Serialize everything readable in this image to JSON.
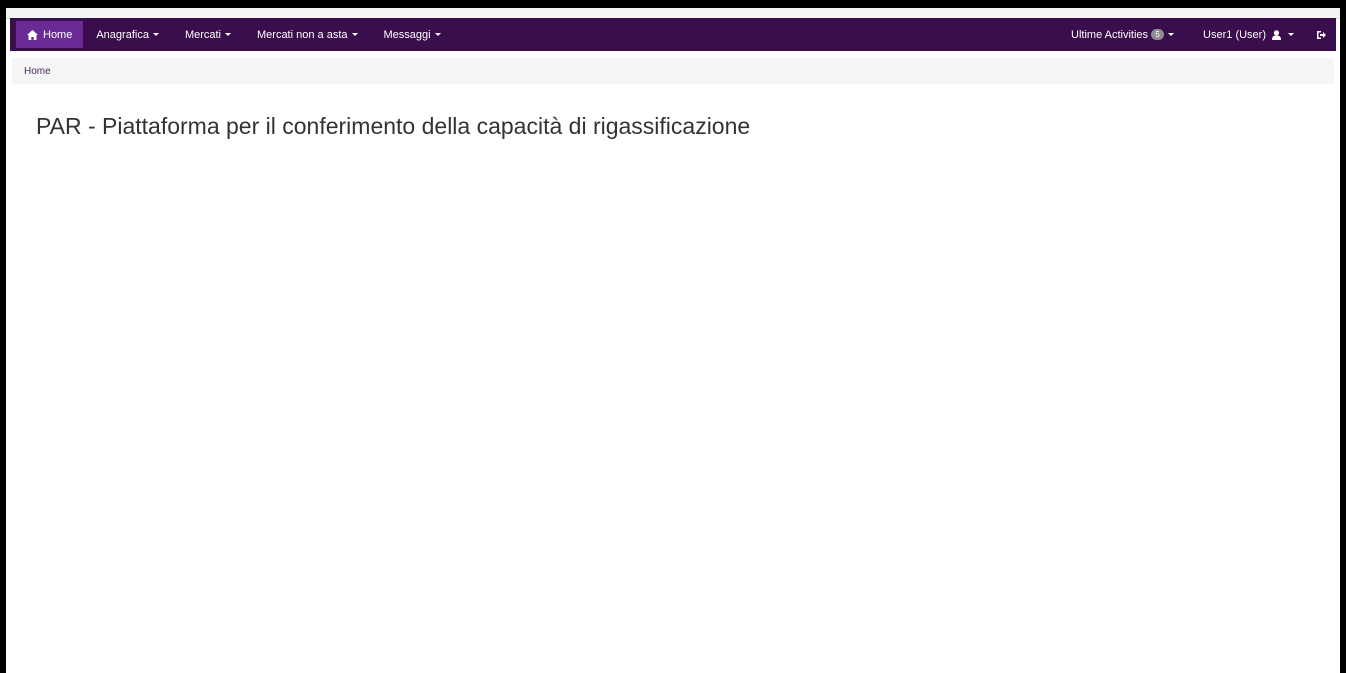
{
  "navbar": {
    "home_label": "Home",
    "menus": [
      {
        "label": "Anagrafica"
      },
      {
        "label": "Mercati"
      },
      {
        "label": "Mercati non a asta"
      },
      {
        "label": "Messaggi"
      }
    ],
    "activities_label": "Ultime Activities",
    "activities_count": "5",
    "user_label": "User1 (User)",
    "icons": {
      "home": "home-icon",
      "user": "user-icon",
      "logout": "logout-icon"
    },
    "colors": {
      "background": "#3a0d4c",
      "active": "#6a2b94"
    }
  },
  "breadcrumb": {
    "current": "Home"
  },
  "main": {
    "title": "PAR - Piattaforma per il conferimento della capacità di rigassificazione"
  }
}
